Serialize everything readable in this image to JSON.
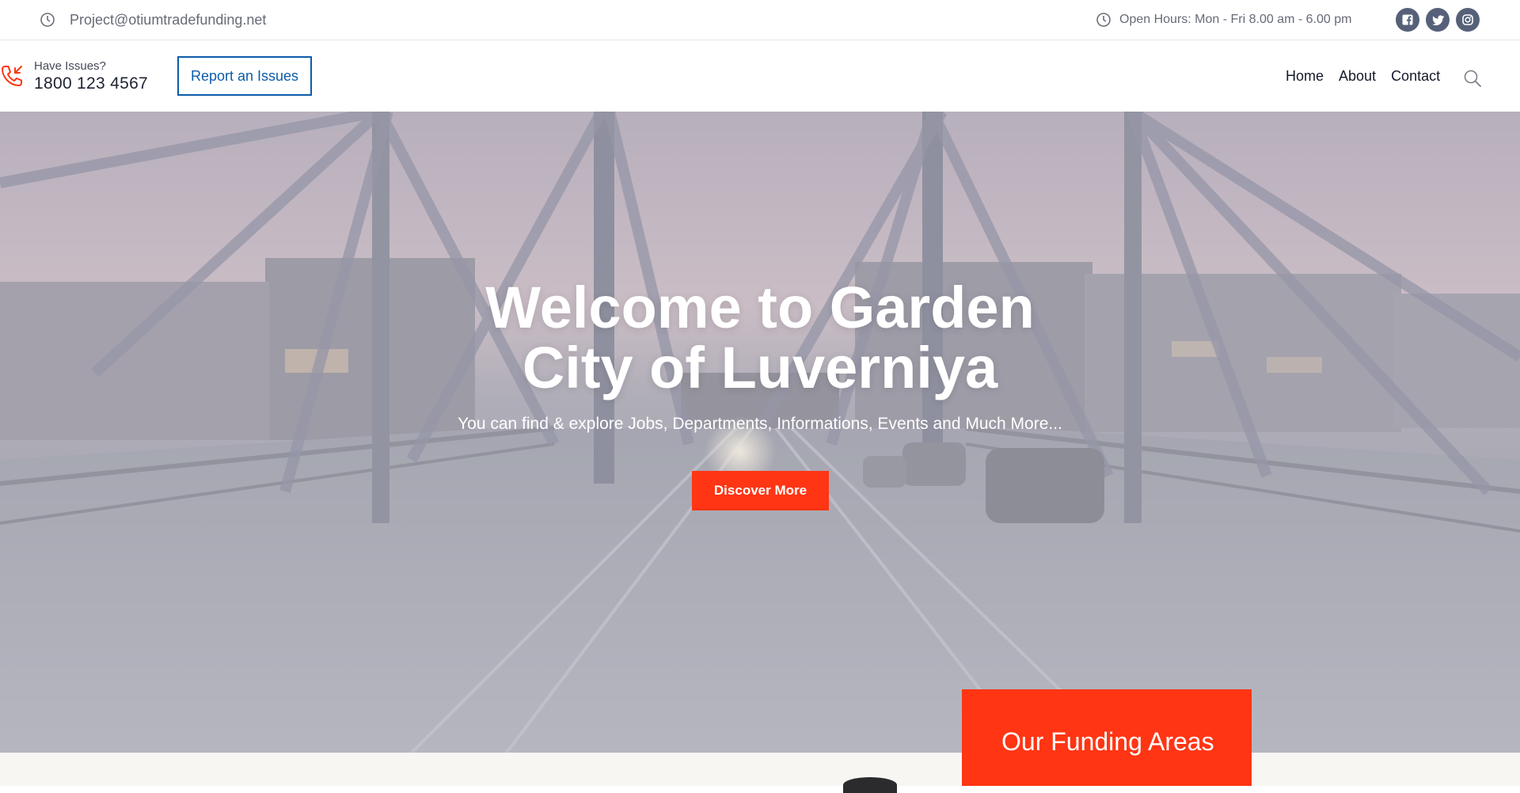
{
  "topbar": {
    "email": "Project@otiumtradefunding.net",
    "hours": "Open Hours: Mon - Fri 8.00 am - 6.00 pm",
    "social": [
      "facebook-icon",
      "twitter-icon",
      "instagram-icon"
    ]
  },
  "header": {
    "issues_label": "Have Issues?",
    "issues_number": "1800 123 4567",
    "report_button": "Report an Issues",
    "nav": [
      "Home",
      "About",
      "Contact"
    ]
  },
  "hero": {
    "title": "Welcome to Garden City of Luverniya",
    "subtitle": "You can find & explore Jobs, Departments, Informations, Events and Much More...",
    "cta": "Discover More"
  },
  "funding": {
    "title": "Our Funding Areas"
  },
  "colors": {
    "accent": "#ff3514",
    "link_blue": "#0d5ca8",
    "social_bg": "#566179"
  }
}
